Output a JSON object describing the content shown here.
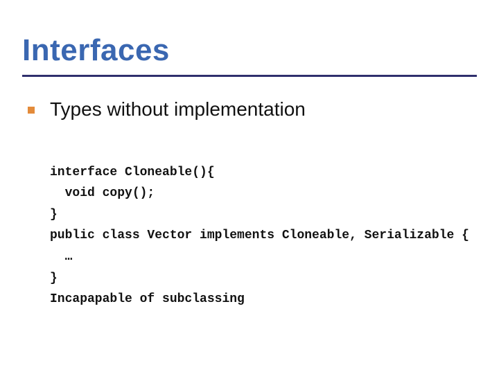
{
  "title": "Interfaces",
  "bullets": [
    {
      "text": "Types without implementation"
    }
  ],
  "code_lines": [
    "interface Cloneable(){",
    "  void copy();",
    "}",
    "public class Vector implements Cloneable, Serializable {",
    "  …",
    "}",
    "Incapapable of subclassing"
  ],
  "colors": {
    "title": "#3a67b1",
    "rule": "#2f2f6d",
    "bullet_marker": "#e38b3a",
    "text": "#111111"
  }
}
